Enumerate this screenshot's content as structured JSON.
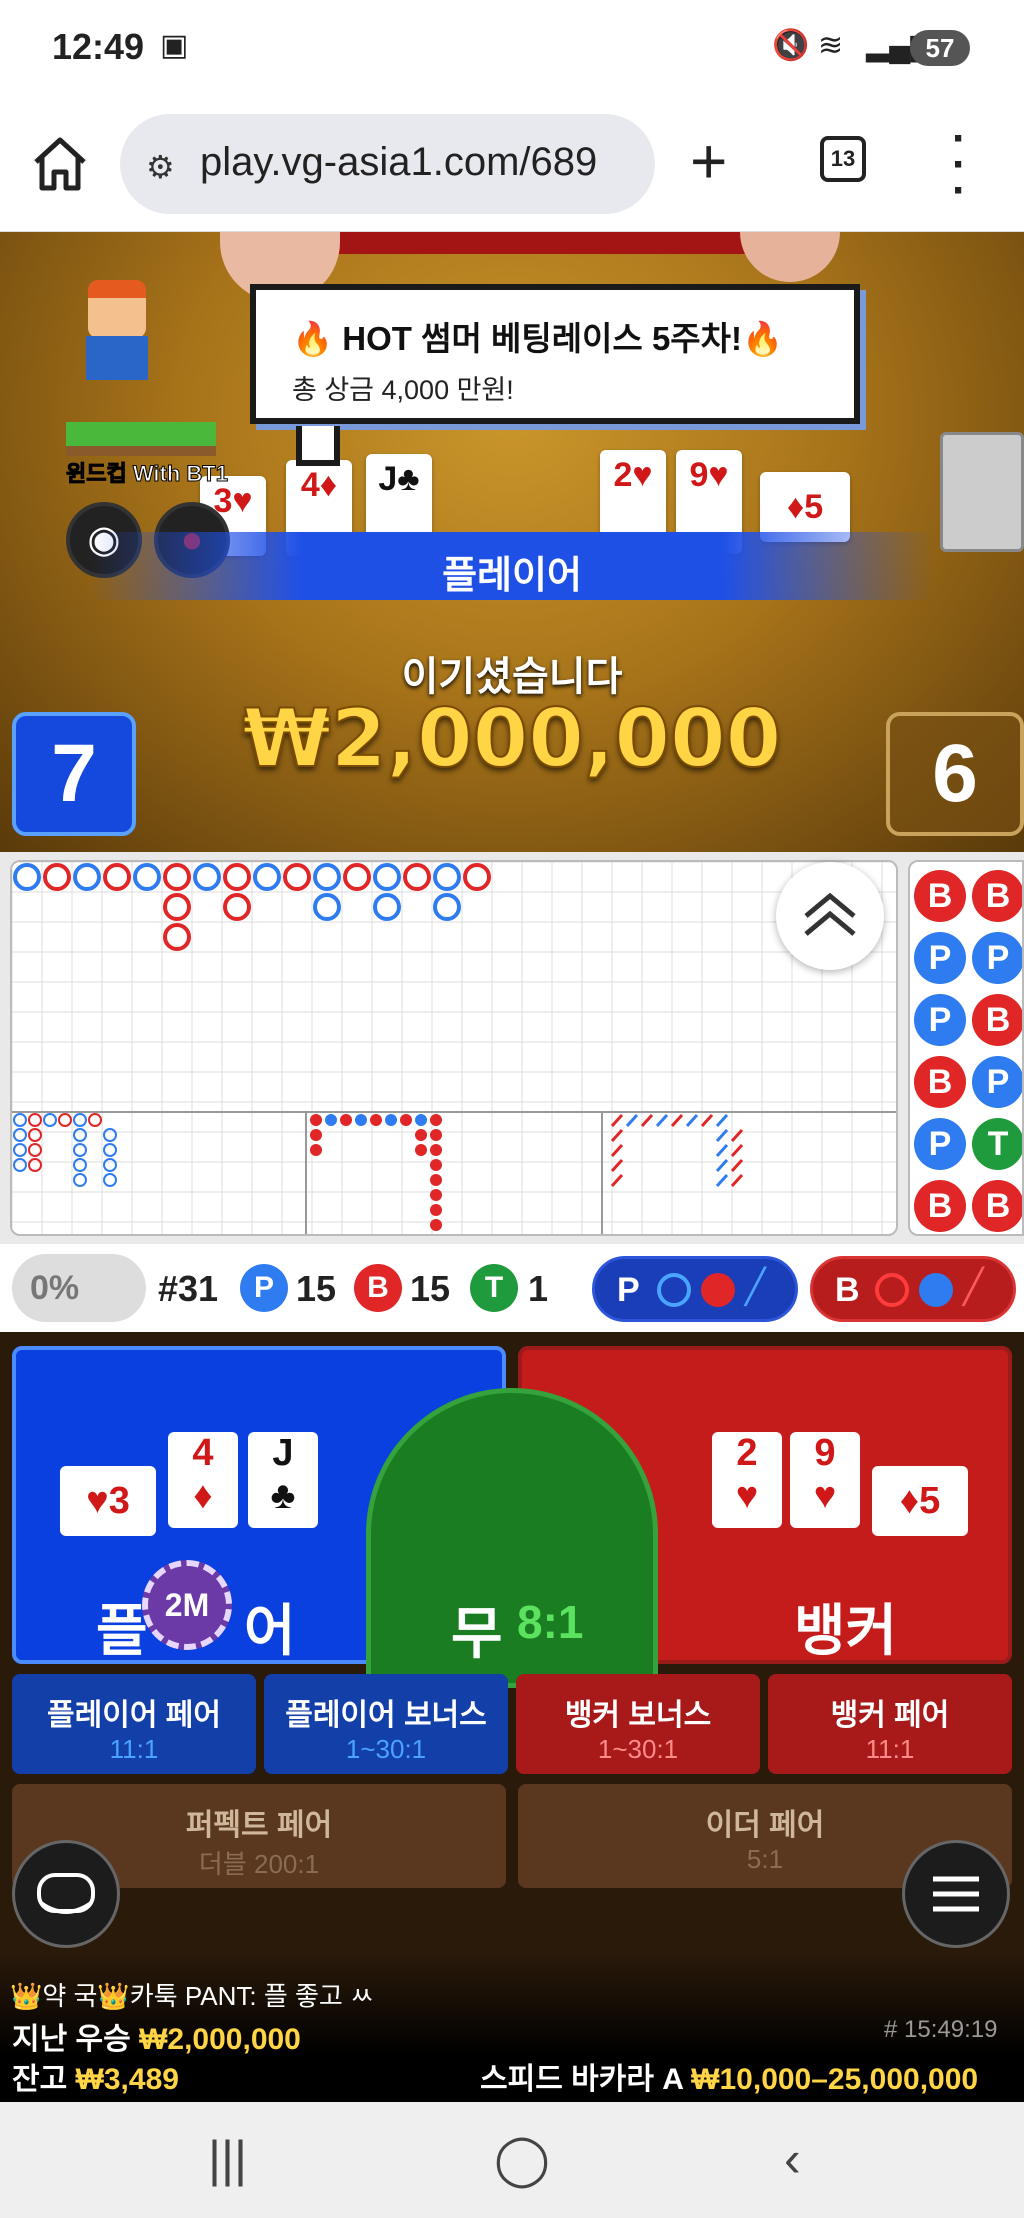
{
  "status_bar": {
    "time": "12:49",
    "battery": "57"
  },
  "browser": {
    "url": "play.vg-asia1.com/689",
    "tab_count": "13"
  },
  "game": {
    "promo_title": "🔥 HOT 썸머 베팅레이스 5주차!🔥",
    "promo_sub": "총 상금 4,000 만원!",
    "nickname": "윈드컵 With BT1",
    "winner_label": "플레이어",
    "win_message": "이기셨습니다",
    "win_amount": "₩2,000,000",
    "player_score": "7",
    "banker_score": "6",
    "table_cards": {
      "player": [
        {
          "rank": "3",
          "suit": "♥"
        },
        {
          "rank": "4",
          "suit": "♦"
        },
        {
          "rank": "J",
          "suit": "♣"
        }
      ],
      "banker": [
        {
          "rank": "2",
          "suit": "♥"
        },
        {
          "rank": "9",
          "suit": "♥"
        },
        {
          "rank": "5",
          "suit": "♦"
        }
      ]
    }
  },
  "stats": {
    "percent": "0%",
    "round": "#31",
    "p_label": "P",
    "p_count": "15",
    "b_label": "B",
    "b_count": "15",
    "t_label": "T",
    "t_count": "1",
    "predict_p": "P",
    "predict_b": "B"
  },
  "bead_road": [
    "B",
    "B",
    "P",
    "P",
    "P",
    "B",
    "B",
    "P",
    "P",
    "T",
    "B",
    "B"
  ],
  "bets": {
    "player": "플레이어",
    "player_visible_left": "플",
    "player_visible_right": "어",
    "tie": "무",
    "tie_odds": "8:1",
    "banker": "뱅커",
    "chip": "2M",
    "player_pair": "플레이어 페어",
    "player_pair_odds": "11:1",
    "player_bonus": "플레이어 보너스",
    "player_bonus_odds": "1~30:1",
    "banker_bonus": "뱅커 보너스",
    "banker_bonus_odds": "1~30:1",
    "banker_pair": "뱅커 페어",
    "banker_pair_odds": "11:1",
    "perfect_pair": "퍼펙트 페어",
    "perfect_pair_odds": "더블 200:1",
    "either_pair": "이더 페어",
    "either_pair_odds": "5:1"
  },
  "footer": {
    "chat": "👑약 국👑카툭 PANT: 플 좋고 ㅆ",
    "last_win_label": "지난 우승",
    "last_win_amount": "₩2,000,000",
    "round_time": "# 15:49:19",
    "balance_label": "잔고",
    "balance": "₩3,489",
    "table_name": "스피드 바카라 A",
    "limits": "₩10,000–25,000,000"
  },
  "colors": {
    "player": "#1f50e6",
    "banker": "#c41b1b",
    "tie": "#1a7d22",
    "gold": "#ffd445"
  }
}
